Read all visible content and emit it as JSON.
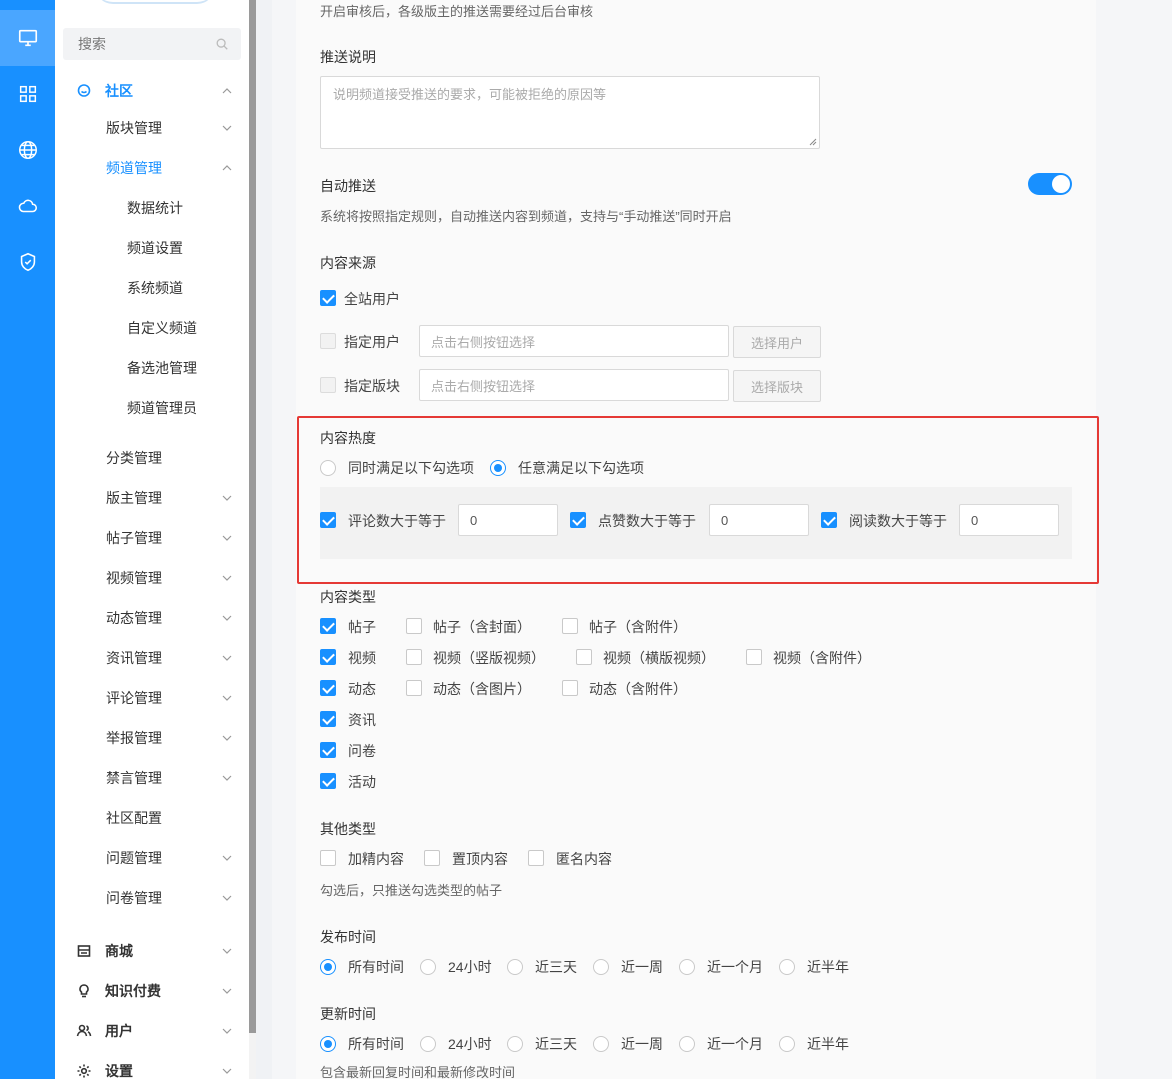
{
  "rail": {
    "items": [
      {
        "icon": "monitor-icon",
        "active": true
      },
      {
        "icon": "apps-grid-icon",
        "active": false
      },
      {
        "icon": "globe-icon",
        "active": false
      },
      {
        "icon": "cloud-icon",
        "active": false
      },
      {
        "icon": "shield-check-icon",
        "active": false
      }
    ]
  },
  "menu": {
    "search_placeholder": "搜索",
    "community": "社区",
    "items": {
      "block_mgmt": "版块管理",
      "channel_mgmt": "频道管理",
      "data_stats": "数据统计",
      "channel_settings": "频道设置",
      "system_channel": "系统频道",
      "custom_channel": "自定义频道",
      "candidate_pool": "备选池管理",
      "channel_admin": "频道管理员",
      "category_mgmt": "分类管理",
      "moderator_mgmt": "版主管理",
      "post_mgmt": "帖子管理",
      "video_mgmt": "视频管理",
      "moment_mgmt": "动态管理",
      "news_mgmt": "资讯管理",
      "comment_mgmt": "评论管理",
      "report_mgmt": "举报管理",
      "mute_mgmt": "禁言管理",
      "community_config": "社区配置",
      "question_mgmt": "问题管理",
      "survey_mgmt": "问卷管理"
    },
    "mall": "商城",
    "knowledge": "知识付费",
    "users": "用户",
    "settings": "设置"
  },
  "form": {
    "review_hint": "开启审核后，各级版主的推送需要经过后台审核",
    "push_desc_label": "推送说明",
    "push_desc_placeholder": "说明频道接受推送的要求，可能被拒绝的原因等",
    "auto_push_label": "自动推送",
    "auto_push_on": true,
    "auto_push_hint": "系统将按照指定规则，自动推送内容到频道，支持与“手动推送”同时开启",
    "source_label": "内容来源",
    "source_all": "全站用户",
    "source_user": "指定用户",
    "source_block": "指定版块",
    "pick_placeholder": "点击右侧按钮选择",
    "select_user_btn": "选择用户",
    "select_block_btn": "选择版块",
    "heat_label": "内容热度",
    "heat_all": "同时满足以下勾选项",
    "heat_any": "任意满足以下勾选项",
    "heat_comments": "评论数大于等于",
    "heat_likes": "点赞数大于等于",
    "heat_views": "阅读数大于等于",
    "heat_comments_val": "0",
    "heat_likes_val": "0",
    "heat_views_val": "0",
    "type_label": "内容类型",
    "types": {
      "post": "帖子",
      "post_cover": "帖子（含封面）",
      "post_attach": "帖子（含附件）",
      "video": "视频",
      "video_vertical": "视频（竖版视频）",
      "video_horizontal": "视频（横版视频）",
      "video_attach": "视频（含附件）",
      "moment": "动态",
      "moment_image": "动态（含图片）",
      "moment_attach": "动态（含附件）",
      "news": "资讯",
      "survey": "问卷",
      "activity": "活动"
    },
    "other_label": "其他类型",
    "other": {
      "featured": "加精内容",
      "pinned": "置顶内容",
      "anonymous": "匿名内容"
    },
    "other_hint": "勾选后，只推送勾选类型的帖子",
    "publish_label": "发布时间",
    "update_label": "更新时间",
    "time_options": [
      "所有时间",
      "24小时",
      "近三天",
      "近一周",
      "近一个月",
      "近半年"
    ],
    "update_hint": "包含最新回复时间和最新修改时间"
  },
  "colors": {
    "primary": "#1890ff",
    "highlight_border": "#e53935"
  }
}
